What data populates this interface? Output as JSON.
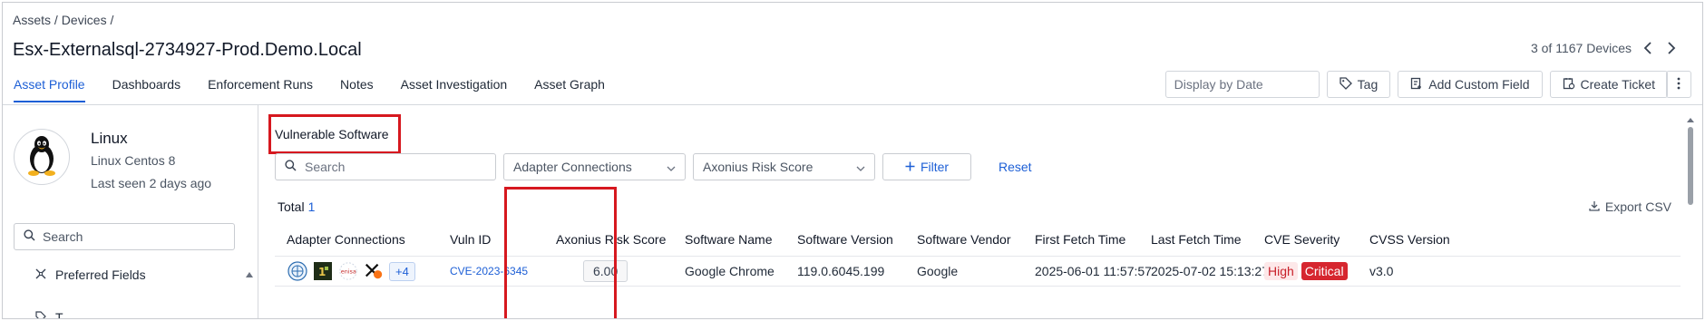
{
  "breadcrumb": {
    "assets": "Assets /",
    "devices": "Devices /"
  },
  "title": "Esx-Externalsql-2734927-Prod.Demo.Local",
  "pager": {
    "text": "3 of 1167 Devices"
  },
  "tabs": [
    {
      "label": "Asset Profile",
      "active": true
    },
    {
      "label": "Dashboards"
    },
    {
      "label": "Enforcement Runs"
    },
    {
      "label": "Notes"
    },
    {
      "label": "Asset Investigation"
    },
    {
      "label": "Asset Graph"
    }
  ],
  "toolbar": {
    "date_placeholder": "Display by Date",
    "tag_label": "Tag",
    "add_field_label": "Add Custom Field",
    "ticket_label": "Create Ticket"
  },
  "device": {
    "os_name": "Linux",
    "os_version": "Linux Centos 8",
    "last_seen": "Last seen 2 days ago",
    "search_placeholder": "Search",
    "preferred_fields": "Preferred Fields",
    "partial_item": "T..."
  },
  "section": {
    "title": "Vulnerable Software",
    "search_placeholder": "Search",
    "adapter_filter": "Adapter Connections",
    "risk_filter": "Axonius Risk Score",
    "filter_label": "Filter",
    "reset_label": "Reset",
    "total_label": "Total",
    "total_value": "1",
    "export_label": "Export CSV"
  },
  "table": {
    "headers": [
      "Adapter Connections",
      "Vuln ID",
      "Axonius Risk Score",
      "Software Name",
      "Software Version",
      "Software Vendor",
      "First Fetch Time",
      "Last Fetch Time",
      "CVE Severity",
      "CVSS Version"
    ],
    "row": {
      "adapters_more": "+4",
      "vuln_id": "CVE-2023-6345",
      "risk_score": "6.00",
      "software_name": "Google Chrome",
      "software_version": "119.0.6045.199",
      "software_vendor": "Google",
      "first_fetch": "2025-06-01 11:57:57",
      "last_fetch": "2025-07-02 15:13:27",
      "severity_1": "High",
      "severity_2": "Critical",
      "cvss_version": "v3.0"
    }
  },
  "colors": {
    "accent": "#1d5fd6",
    "highlight": "#d6181f",
    "critical": "#d6262f"
  }
}
